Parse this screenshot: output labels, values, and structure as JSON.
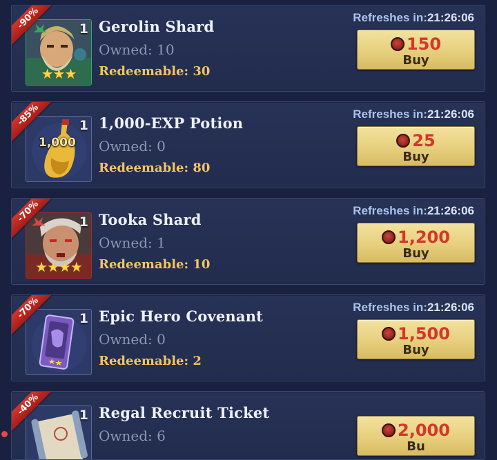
{
  "items": [
    {
      "discount": "-90%",
      "qty": "1",
      "name": "Gerolin Shard",
      "owned": "Owned:  10",
      "redeemable": "Redeemable: 30",
      "refresh_label": "Refreshes in:",
      "refresh_time": "21:26:06",
      "price": "150",
      "buy": "Buy",
      "stars": "★★★",
      "icon": "hero-gerolin-portrait",
      "frame": "green"
    },
    {
      "discount": "-85%",
      "qty": "1",
      "name": "1,000-EXP Potion",
      "owned": "Owned:  0",
      "redeemable": "Redeemable: 80",
      "refresh_label": "Refreshes in:",
      "refresh_time": "21:26:06",
      "price": "25",
      "buy": "Buy",
      "stamp": "1,000",
      "icon": "exp-potion-icon",
      "frame": "blue"
    },
    {
      "discount": "-70%",
      "qty": "1",
      "name": "Tooka Shard",
      "owned": "Owned:  1",
      "redeemable": "Redeemable: 10",
      "refresh_label": "Refreshes in:",
      "refresh_time": "21:26:06",
      "price": "1,200",
      "buy": "Buy",
      "stars": "★★★★",
      "icon": "hero-tooka-portrait",
      "frame": "red"
    },
    {
      "discount": "-70%",
      "qty": "1",
      "name": "Epic Hero Covenant",
      "owned": "Owned:  0",
      "redeemable": "Redeemable: 2",
      "refresh_label": "Refreshes in:",
      "refresh_time": "21:26:06",
      "price": "1,500",
      "buy": "Buy",
      "icon": "epic-covenant-card-icon",
      "frame": "blue"
    },
    {
      "discount": "-40%",
      "qty": "1",
      "name": "Regal Recruit Ticket",
      "owned": "Owned:  6",
      "price": "2,000",
      "buy": "Bu",
      "icon": "scroll-ticket-icon",
      "frame": "blue"
    }
  ],
  "colors": {
    "background": "#1a2140",
    "card": "#273257",
    "discount_ribbon": "#c3291f",
    "price_red": "#d6362a",
    "redeemable_gold": "#f2c560",
    "buy_button_gold": "#e6cf7d"
  },
  "currency_icon": "red-gem-coin-icon"
}
